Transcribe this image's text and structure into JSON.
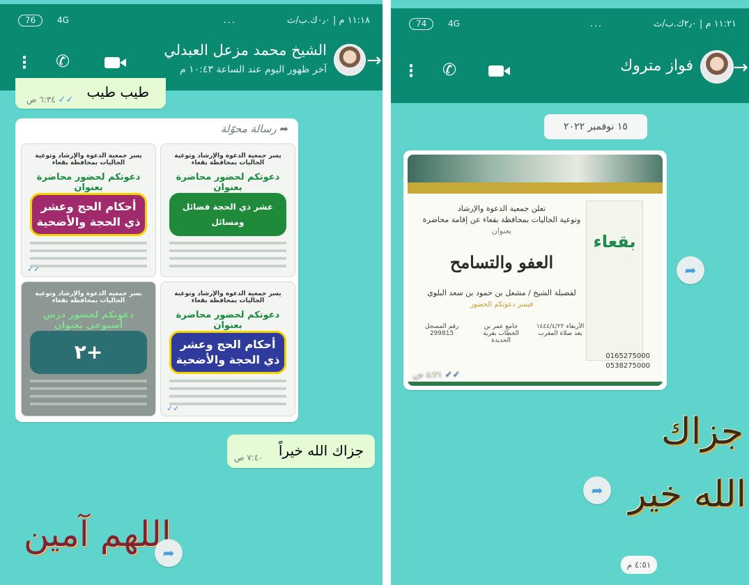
{
  "left": {
    "status": {
      "time": "١١:١٨ م | ٠٫٠ك.ب/ث",
      "extra": "...",
      "battery": "76",
      "network": "4G"
    },
    "header": {
      "name": "الشيخ محمد مزعل العبدلي",
      "last_seen": "آخر ظهور اليوم عند الساعة ١٠:٤٣ م"
    },
    "messages": {
      "prev_text": "طيب طيب",
      "prev_time": "٦:٣٤ ص",
      "forwarded_label": "رسالة محوّلة",
      "flyers": [
        {
          "header": "يسر جمعية الدعوة والإرشاد وتوعية الجاليات بمحافظة بقعاء",
          "invite": "دعوتكم لحضور محاضرة بعنوان",
          "title": "عشر ذي الحجة فضائل ومسائل",
          "color": "#1f8a3a"
        },
        {
          "header": "يسر جمعية الدعوة والإرشاد وتوعية الجاليات بمحافظة بقعاء",
          "invite": "دعوتكم لحضور محاضرة بعنوان",
          "title": "أحكام الحج وعشر ذي الحجة والأضحية",
          "color": "#a02a6b"
        },
        {
          "header": "يسر جمعية الدعوة والإرشاد وتوعية الجاليات بمحافظة بقعاء",
          "invite": "دعوتكم لحضور محاضرة بعنوان",
          "title": "أحكام الحج وعشر ذي الحجة والأضحية",
          "color": "#2e3a9c"
        },
        {
          "header": "يسر جمعية الدعوة والإرشاد وتوعية الجاليات بمحافظة بقعاء",
          "invite": "دعوتكم لحضور درس أسبوعي بعنوان",
          "title": "+٢",
          "color": "#2b6f73"
        }
      ],
      "reply_text": "جزاك الله خيراً",
      "reply_time": "٧:٤٠ ص",
      "sticker_text": "اللهم آمين"
    }
  },
  "right": {
    "status": {
      "time": "١١:٢١ م | ٢٫٠ك.ب/ث",
      "extra": "...",
      "battery": "74",
      "network": "4G"
    },
    "header": {
      "name": "فواز متروك"
    },
    "messages": {
      "date_chip": "١٥ نوفمبر ٢٠٢٢",
      "invite_line1": "تعلن جمعية الدعوة والإرشاد",
      "invite_line2": "وتوعية الجاليات بمحافظة بقعاء عن إقامة محاضرة",
      "subtitle": "بعنوان",
      "lecture_title": "العفو والتسامح",
      "speaker": "لفضيلة الشيخ / مشعل بن حمود بن سعد البلوي",
      "welcome": "فيسر دعوتكم الحضور",
      "logo_text": "بقعاء",
      "phone1": "0165275000",
      "phone2": "0538275000",
      "details": [
        "الأربعاء ١٤٤٤/٤/٢٢ بعد صلاة المغرب",
        "جامع عمر بن الخطاب بقرية الحديدة",
        "رقم المسجل 299815"
      ],
      "image_time": "٨:٢١ ص",
      "sticker_text_1": "جزاك",
      "sticker_text_2": "الله خير",
      "sticker_time": "٤:٥١ م"
    }
  },
  "colors": {
    "header": "#0b8a72",
    "wallpaper": "#5fd4cc",
    "tick": "#3c8ee6"
  }
}
